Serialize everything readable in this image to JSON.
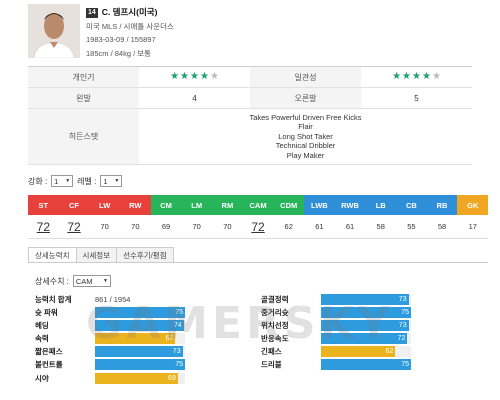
{
  "player": {
    "number": "14",
    "name": "C. 뎀프시(미국)",
    "club": "미국 MLS / 시애틀 사운더스",
    "birth": "1983-03-09 / 155897",
    "body": "185cm / 84kg / 보통"
  },
  "profile": {
    "rows": [
      {
        "left_label": "개인기",
        "left_stars": 4,
        "right_label": "일관성",
        "right_stars": 4
      },
      {
        "left_label": "왼발",
        "left_value": "4",
        "right_label": "오른발",
        "right_value": "5"
      }
    ],
    "hidden_label": "히든스탯",
    "traits": [
      "Takes Powerful Driven Free Kicks",
      "Flair",
      "Long Shot Taker",
      "Technical Dribbler",
      "Play Maker"
    ],
    "star_max": 5
  },
  "enhance": {
    "label": "강화 :",
    "value": "1",
    "level_label": "레벨 :",
    "level_value": "1"
  },
  "positions": {
    "items": [
      {
        "pos": "ST",
        "value": "72",
        "color": "#e8403a",
        "big": true
      },
      {
        "pos": "CF",
        "value": "72",
        "color": "#e8403a",
        "big": true
      },
      {
        "pos": "LW",
        "value": "70",
        "color": "#e8403a"
      },
      {
        "pos": "RW",
        "value": "70",
        "color": "#e8403a"
      },
      {
        "pos": "CM",
        "value": "69",
        "color": "#27b45a"
      },
      {
        "pos": "LM",
        "value": "70",
        "color": "#27b45a"
      },
      {
        "pos": "RM",
        "value": "70",
        "color": "#27b45a"
      },
      {
        "pos": "CAM",
        "value": "72",
        "color": "#27b45a",
        "big": true
      },
      {
        "pos": "CDM",
        "value": "62",
        "color": "#27b45a"
      },
      {
        "pos": "LWB",
        "value": "61",
        "color": "#2e8fd8"
      },
      {
        "pos": "RWB",
        "value": "61",
        "color": "#2e8fd8"
      },
      {
        "pos": "LB",
        "value": "58",
        "color": "#2e8fd8"
      },
      {
        "pos": "CB",
        "value": "55",
        "color": "#2e8fd8"
      },
      {
        "pos": "RB",
        "value": "58",
        "color": "#2e8fd8"
      },
      {
        "pos": "GK",
        "value": "17",
        "color": "#f0a623"
      }
    ]
  },
  "tabs": [
    "상세능력치",
    "시세정보",
    "선수후기/평점"
  ],
  "detail": {
    "label": "상세수치 :",
    "value": "CAM"
  },
  "stats": {
    "total_label": "능력치 합계",
    "total_value": "861 / 1954",
    "left": [
      {
        "label": "슛 파워",
        "value": "75",
        "color": "#2e9bde"
      },
      {
        "label": "헤딩",
        "value": "74",
        "color": "#2e9bde"
      },
      {
        "label": "속력",
        "value": "67",
        "color": "#ebb31d"
      },
      {
        "label": "짧은패스",
        "value": "73",
        "color": "#2e9bde"
      },
      {
        "label": "볼컨트롤",
        "value": "75",
        "color": "#2e9bde"
      },
      {
        "label": "시야",
        "value": "69",
        "color": "#ebb31d"
      }
    ],
    "right": [
      {
        "label": "골결정력",
        "value": "73",
        "color": "#2e9bde"
      },
      {
        "label": "중거리슛",
        "value": "75",
        "color": "#2e9bde"
      },
      {
        "label": "위치선정",
        "value": "73",
        "color": "#2e9bde"
      },
      {
        "label": "반응속도",
        "value": "72",
        "color": "#2e9bde"
      },
      {
        "label": "긴패스",
        "value": "62",
        "color": "#ebb31d"
      },
      {
        "label": "드리블",
        "value": "75",
        "color": "#2e9bde"
      }
    ]
  },
  "watermark": "GAMERSKY"
}
